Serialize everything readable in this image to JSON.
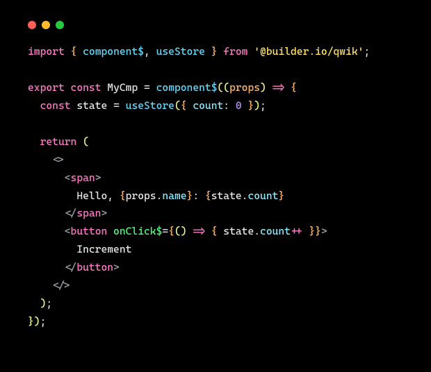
{
  "code": {
    "kw_import": "import",
    "brace_open1": "{",
    "imp_component": "component$",
    "comma1": ", ",
    "imp_useStore": "useStore",
    "brace_close1": "}",
    "kw_from": "from",
    "str_pkg": "'@builder.io/qwik'",
    "semi1": ";",
    "kw_export": "export",
    "kw_const1": "const",
    "name_mycmp": "MyCmp",
    "eq1": " = ",
    "fn_component": "component$",
    "paren_open1": "((",
    "param_props": "props",
    "paren_close1": ")",
    "arrow1": " => ",
    "brace_open2": "{",
    "kw_const2": "const",
    "name_state": "state",
    "eq2": " = ",
    "fn_useStore": "useStore",
    "paren_open2": "(",
    "brace_open3": "{ ",
    "prop_count": "count",
    "colon1": ": ",
    "num_zero": "0",
    "brace_close3": " }",
    "paren_close2": ")",
    "semi2": ";",
    "kw_return": "return",
    "paren_open3": " (",
    "frag_open": "<>",
    "tag_span_open_l": "<",
    "tag_span": "span",
    "tag_span_open_r": ">",
    "txt_hello": "Hello, ",
    "expr_open1": "{",
    "expr_props": "props",
    "dot1": ".",
    "expr_name": "name",
    "expr_close1": "}",
    "txt_colon": ": ",
    "expr_open2": "{",
    "expr_state": "state",
    "dot2": ".",
    "expr_count": "count",
    "expr_close2": "}",
    "tag_span_close_l": "</",
    "tag_span_close_r": ">",
    "tag_button_open_l": "<",
    "tag_button": "button",
    "attr_onclick": " onClick$",
    "attr_eq": "=",
    "attr_brace_open": "{",
    "cb_paren": "()",
    "arrow2": " => ",
    "cb_brace_open": "{ ",
    "cb_state": "state",
    "dot3": ".",
    "cb_count": "count",
    "cb_inc": "++",
    "cb_brace_close": " }",
    "attr_brace_close": "}",
    "tag_button_open_r": ">",
    "txt_increment": "Increment",
    "tag_button_close_l": "</",
    "tag_button_close_r": ">",
    "frag_close": "</>",
    "paren_close3": ")",
    "semi3": ";",
    "brace_close_outer": "})",
    "semi4": ";"
  }
}
